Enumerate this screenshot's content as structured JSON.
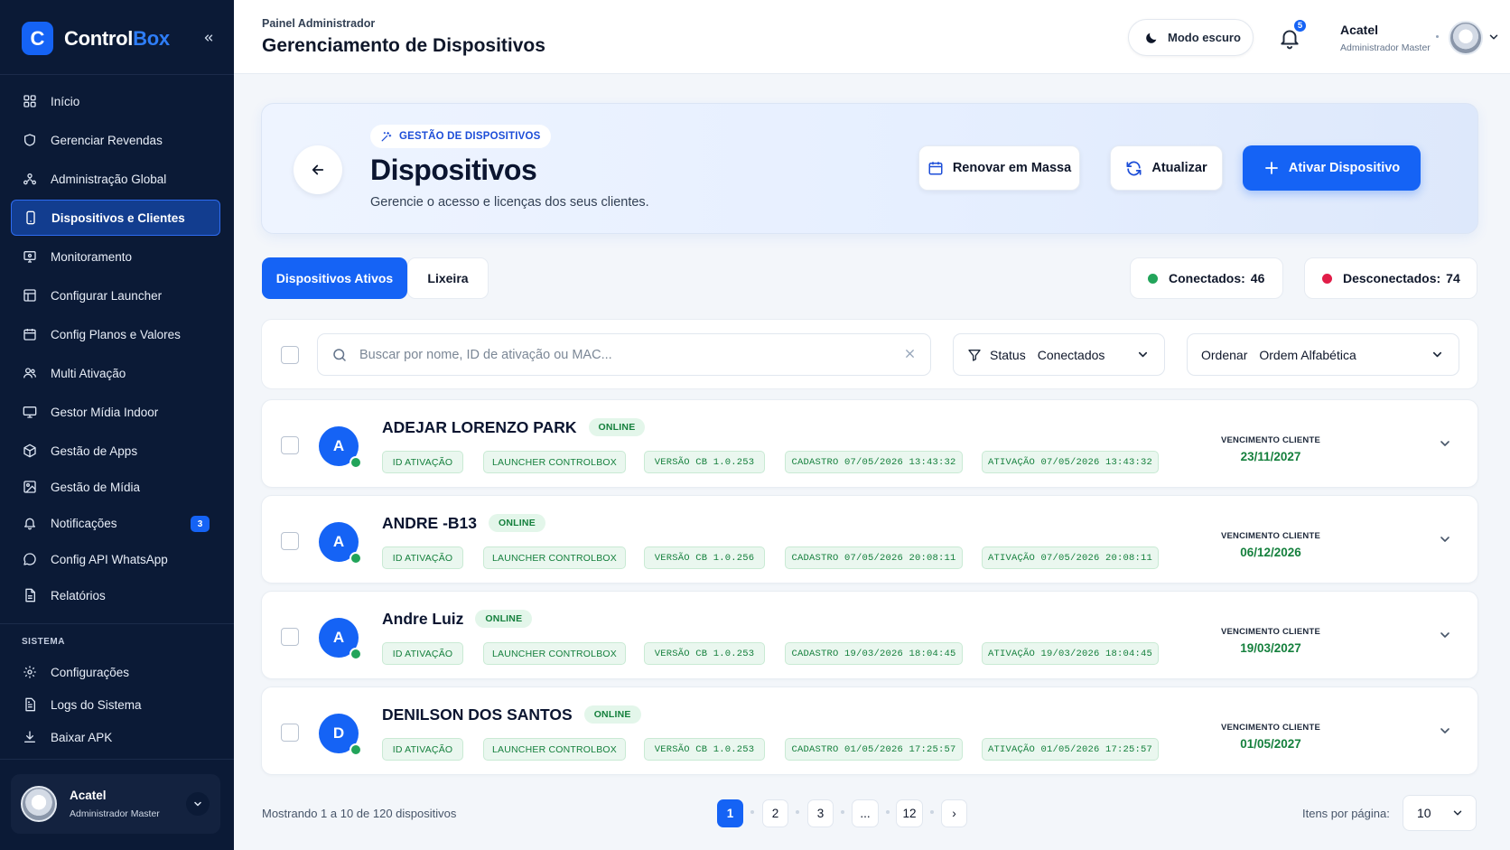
{
  "sidebar": {
    "brand_letter": "C",
    "brand_name_main": "Control",
    "brand_name_accent": "Box",
    "items": [
      {
        "label": "Início",
        "icon": "grid-icon",
        "active": false
      },
      {
        "label": "Gerenciar Revendas",
        "icon": "shield-icon",
        "active": false
      },
      {
        "label": "Administração Global",
        "icon": "network-users-icon",
        "active": false
      },
      {
        "label": "Dispositivos e Clientes",
        "icon": "smartphone-icon",
        "active": true
      },
      {
        "label": "Monitoramento",
        "icon": "monitor-icon",
        "active": false
      },
      {
        "label": "Configurar Launcher",
        "icon": "layout-icon",
        "active": false
      },
      {
        "label": "Config Planos e Valores",
        "icon": "calendar-icon",
        "active": false
      },
      {
        "label": "Multi Ativação",
        "icon": "users-icon",
        "active": false
      },
      {
        "label": "Gestor Mídia Indoor",
        "icon": "tv-icon",
        "active": false
      },
      {
        "label": "Gestão de Apps",
        "icon": "package-icon",
        "active": false
      },
      {
        "label": "Gestão de Mídia",
        "icon": "image-icon",
        "active": false
      },
      {
        "label": "Notificações",
        "icon": "bell-icon",
        "active": false,
        "badge": "3"
      },
      {
        "label": "Config API WhatsApp",
        "icon": "chat-icon",
        "active": false
      },
      {
        "label": "Relatórios",
        "icon": "file-icon",
        "active": false
      }
    ],
    "system_label": "SISTEMA",
    "system_items": [
      {
        "label": "Configurações",
        "icon": "gear-icon"
      },
      {
        "label": "Logs do Sistema",
        "icon": "file-text-icon"
      },
      {
        "label": "Baixar APK",
        "icon": "download-icon"
      }
    ],
    "user": {
      "name": "Acatel",
      "role": "Administrador Master"
    }
  },
  "header": {
    "breadcrumb": "Painel Administrador",
    "title": "Gerenciamento de Dispositivos",
    "dark_mode_label": "Modo escuro",
    "notification_count": "5",
    "user_name": "Acatel",
    "user_role": "Administrador Master"
  },
  "hero": {
    "pill": "GESTÃO DE DISPOSITIVOS",
    "title": "Dispositivos",
    "subtitle": "Gerencie o acesso e licenças dos seus clientes.",
    "renew_label": "Renovar em Massa",
    "refresh_label": "Atualizar",
    "activate_label": "Ativar Dispositivo"
  },
  "tabs": [
    {
      "label": "Dispositivos Ativos",
      "active": true
    },
    {
      "label": "Lixeira",
      "active": false
    }
  ],
  "stats": {
    "connected_label": "Conectados:",
    "connected_count": "46",
    "connected_color": "#22a45a",
    "disconnected_label": "Desconectados:",
    "disconnected_count": "74",
    "disconnected_color": "#e11d48"
  },
  "filters": {
    "search_placeholder": "Buscar por nome, ID de ativação ou MAC...",
    "status_label": "Status",
    "status_value": "Conectados",
    "order_label": "Ordenar",
    "order_value": "Ordem Alfabética"
  },
  "devices": [
    {
      "initial": "A",
      "name": "ADEJAR LORENZO PARK",
      "status": "ONLINE",
      "chip_id": "ID ATIVAÇÃO",
      "chip_launcher": "LAUNCHER CONTROLBOX",
      "chip_version": "VERSÃO CB 1.0.253",
      "chip_created": "CADASTRO 07/05/2026 13:43:32",
      "chip_activated": "ATIVAÇÃO 07/05/2026 13:43:32",
      "expiry_label": "VENCIMENTO CLIENTE",
      "expiry_date": "23/11/2027"
    },
    {
      "initial": "A",
      "name": "ANDRE -B13",
      "status": "ONLINE",
      "chip_id": "ID ATIVAÇÃO",
      "chip_launcher": "LAUNCHER CONTROLBOX",
      "chip_version": "VERSÃO CB 1.0.256",
      "chip_created": "CADASTRO 07/05/2026 20:08:11",
      "chip_activated": "ATIVAÇÃO 07/05/2026 20:08:11",
      "expiry_label": "VENCIMENTO CLIENTE",
      "expiry_date": "06/12/2026"
    },
    {
      "initial": "A",
      "name": "Andre Luiz",
      "status": "ONLINE",
      "chip_id": "ID ATIVAÇÃO",
      "chip_launcher": "LAUNCHER CONTROLBOX",
      "chip_version": "VERSÃO CB 1.0.253",
      "chip_created": "CADASTRO 19/03/2026 18:04:45",
      "chip_activated": "ATIVAÇÃO 19/03/2026 18:04:45",
      "expiry_label": "VENCIMENTO CLIENTE",
      "expiry_date": "19/03/2027"
    },
    {
      "initial": "D",
      "name": "DENILSON DOS SANTOS",
      "status": "ONLINE",
      "chip_id": "ID ATIVAÇÃO",
      "chip_launcher": "LAUNCHER CONTROLBOX",
      "chip_version": "VERSÃO CB 1.0.253",
      "chip_created": "CADASTRO 01/05/2026 17:25:57",
      "chip_activated": "ATIVAÇÃO 01/05/2026 17:25:57",
      "expiry_label": "VENCIMENTO CLIENTE",
      "expiry_date": "01/05/2027"
    }
  ],
  "pagination": {
    "summary": "Mostrando 1 a 10 de 120 dispositivos",
    "pages": [
      "1",
      "2",
      "3",
      "...",
      "12"
    ],
    "next_symbol": "›",
    "per_page_label": "Itens por página:",
    "per_page_value": "10"
  },
  "colors": {
    "primary": "#1563f5",
    "sidebar_bg": "#0b1a36",
    "success": "#15803d"
  }
}
